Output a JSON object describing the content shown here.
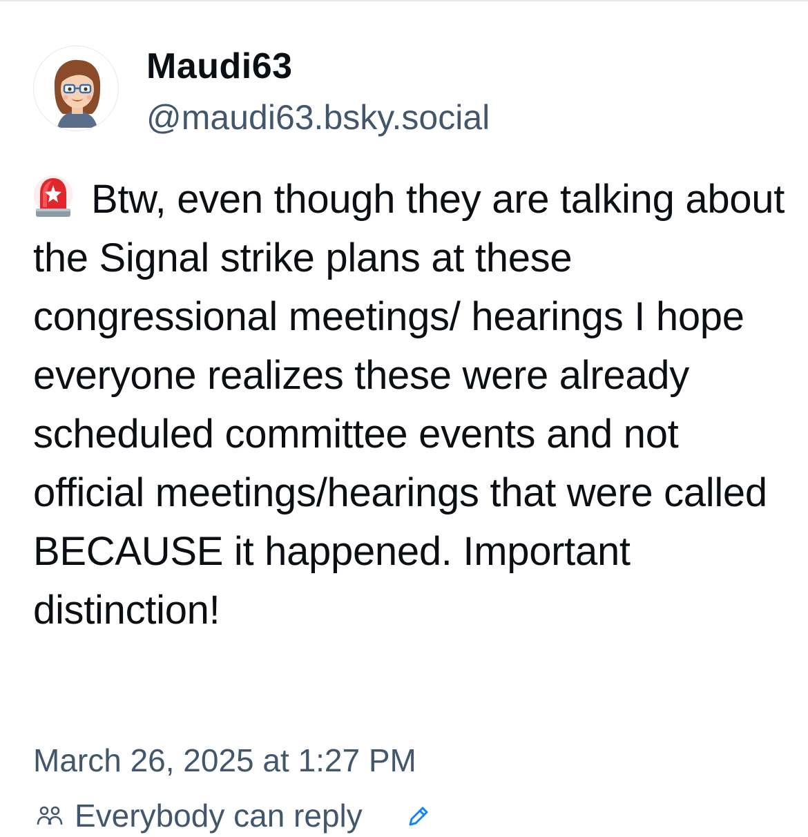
{
  "post": {
    "author": {
      "display_name": "Maudi63",
      "handle": "@maudi63.bsky.social",
      "avatar_icon": "cartoon-avatar-icon"
    },
    "text": "Btw, even though they are talking about the Signal strike plans at these congressional meetings/ hearings I hope everyone realizes these were already scheduled committee events and not official meetings/hearings that were called BECAUSE it happened. Important distinction!",
    "leading_emoji_icon": "siren-icon",
    "timestamp": "March 26, 2025 at 1:27 PM",
    "reply_setting": "Everybody can reply",
    "reply_icon": "people-icon",
    "edit_icon": "pencil-icon"
  },
  "colors": {
    "text_primary": "#0b0f14",
    "text_secondary": "#42576c",
    "accent": "#1083fe",
    "divider": "#e3e7ec"
  }
}
